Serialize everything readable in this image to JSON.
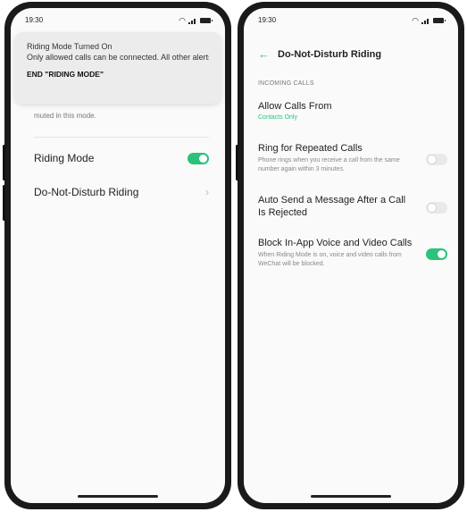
{
  "left_phone": {
    "status": {
      "time": "19:30"
    },
    "notification": {
      "title": "Riding Mode Turned On",
      "body": "Only allowed calls can be connected. All other alerts ...",
      "action": "END \"RIDING MODE\""
    },
    "muted_text": "muted in this mode.",
    "items": [
      {
        "label": "Riding Mode",
        "toggle": true
      },
      {
        "label": "Do-Not-Disturb Riding"
      }
    ]
  },
  "right_phone": {
    "status": {
      "time": "19:30"
    },
    "header": {
      "title": "Do-Not-Disturb Riding"
    },
    "section": "INCOMING CALLS",
    "settings": [
      {
        "title": "Allow Calls From",
        "value": "Contacts Only"
      },
      {
        "title": "Ring for Repeated Calls",
        "subtitle": "Phone rings when you receive a call from the same number again within 3 minutes.",
        "toggle": false
      },
      {
        "title": "Auto Send a Message After a Call Is Rejected",
        "toggle": false
      },
      {
        "title": "Block In-App Voice and Video Calls",
        "subtitle": "When Riding Mode is on, voice and video calls from WeChat will be blocked.",
        "toggle": true
      }
    ]
  },
  "colors": {
    "accent": "#2bc27a",
    "background": "#fafafa",
    "toggle_off": "#e9e9e9"
  },
  "icons": [
    "wifi-icon",
    "signal-icon",
    "battery-icon",
    "back-arrow-icon",
    "chevron-right-icon"
  ]
}
